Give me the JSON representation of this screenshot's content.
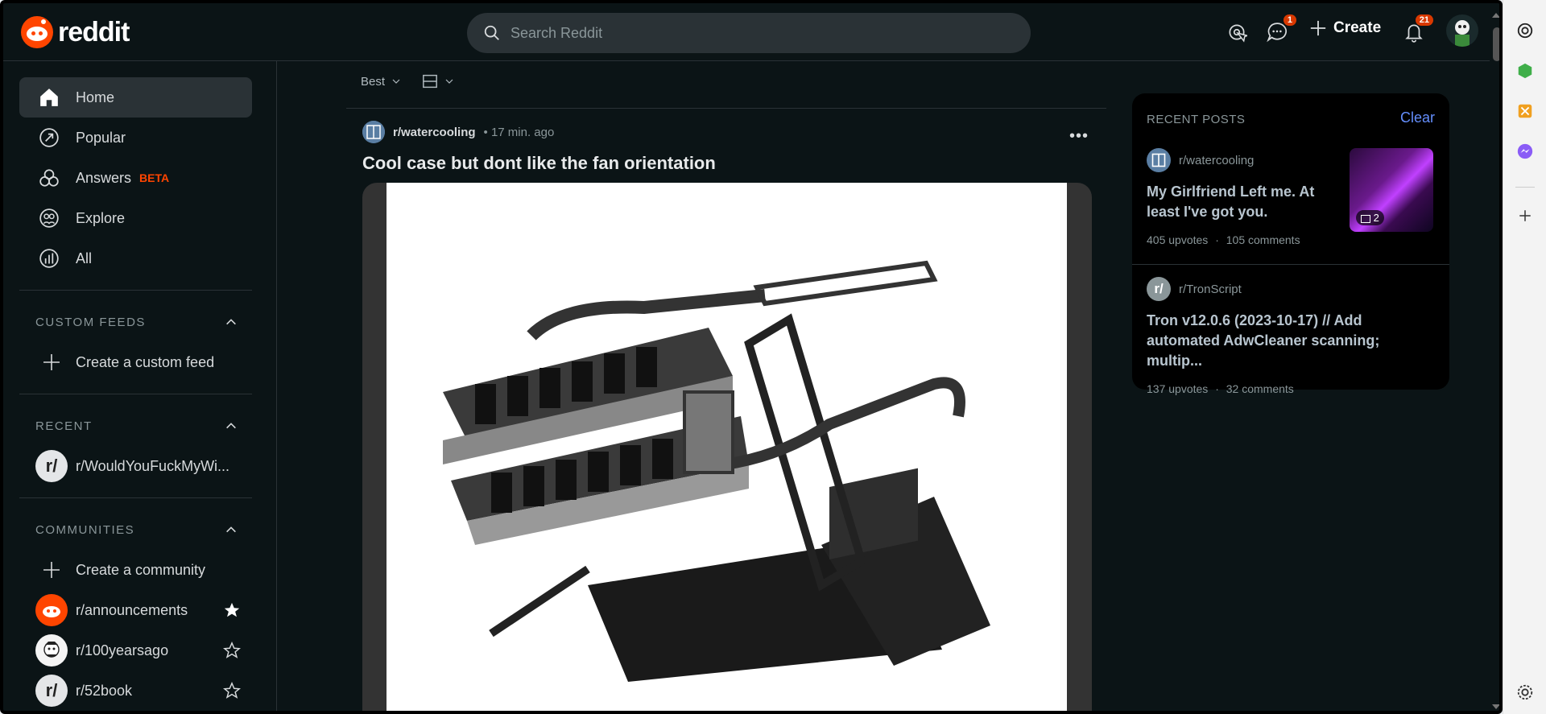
{
  "header": {
    "logo_text": "reddit",
    "search_placeholder": "Search Reddit",
    "chat_badge": "1",
    "create_label": "Create",
    "notifications_badge": "21"
  },
  "sidebar": {
    "nav": [
      {
        "label": "Home",
        "icon": "home-icon"
      },
      {
        "label": "Popular",
        "icon": "popular-icon"
      },
      {
        "label": "Answers",
        "icon": "answers-icon",
        "badge": "BETA"
      },
      {
        "label": "Explore",
        "icon": "explore-icon"
      },
      {
        "label": "All",
        "icon": "all-icon"
      }
    ],
    "custom_feeds": {
      "header": "CUSTOM FEEDS",
      "create_label": "Create a custom feed"
    },
    "recent": {
      "header": "RECENT",
      "items": [
        {
          "label": "r/WouldYouFuckMyWi..."
        }
      ]
    },
    "communities": {
      "header": "COMMUNITIES",
      "create_label": "Create a community",
      "items": [
        {
          "label": "r/announcements",
          "starred": true
        },
        {
          "label": "r/100yearsago",
          "starred": false
        },
        {
          "label": "r/52book",
          "starred": false
        }
      ]
    }
  },
  "feed": {
    "sort_label": "Best"
  },
  "post": {
    "subreddit": "r/watercooling",
    "time": "• 17 min. ago",
    "title": "Cool case but dont like the fan orientation",
    "menu": "•••"
  },
  "recent_posts": {
    "header": "RECENT POSTS",
    "clear_label": "Clear",
    "items": [
      {
        "subreddit": "r/watercooling",
        "title": "My Girlfriend Left me. At least I've got you.",
        "upvotes": "405 upvotes",
        "comments": "105 comments",
        "thumb_count": "2"
      },
      {
        "subreddit": "r/TronScript",
        "title": "Tron v12.0.6 (2023-10-17) // Add automated AdwCleaner scanning; multip...",
        "upvotes": "137 upvotes",
        "comments": "32 comments"
      }
    ],
    "separator": "·"
  },
  "colors": {
    "background": "#0b1416",
    "accent": "#ff4500",
    "link": "#648efc"
  }
}
